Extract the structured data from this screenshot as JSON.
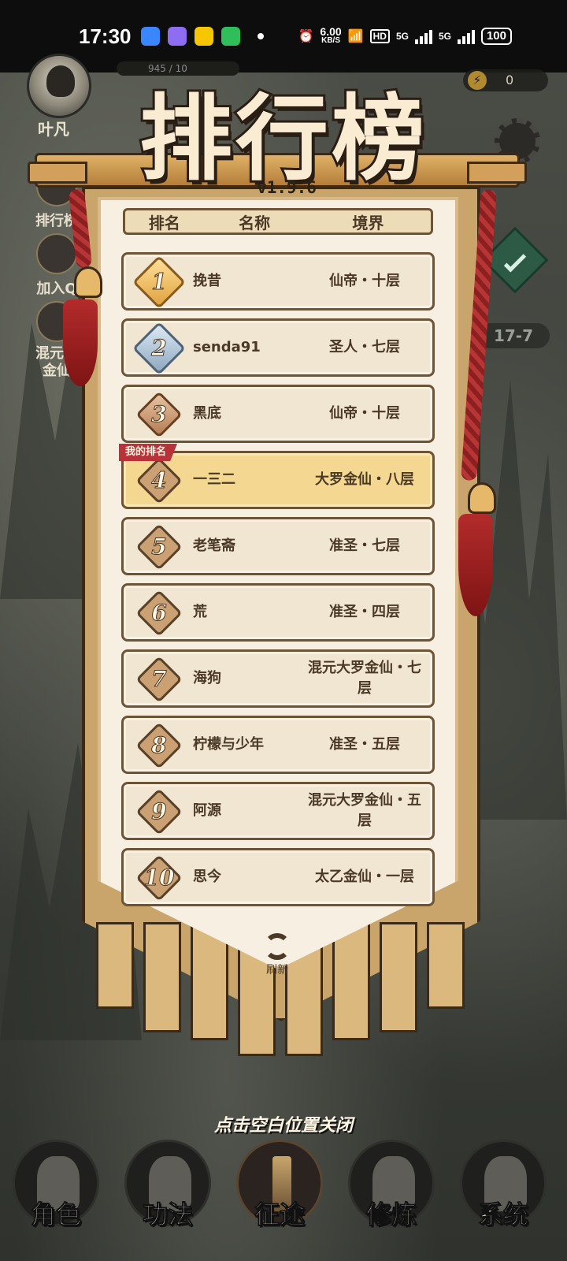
{
  "status_bar": {
    "time": "17:30",
    "net_speed": "6.00",
    "net_unit": "KB/S",
    "hd": "HD",
    "signal1": "5G",
    "signal2": "5G",
    "battery": "100",
    "app_colors": [
      "#3a86ff",
      "#8f6df2",
      "#f7c600",
      "#2fbf5a"
    ]
  },
  "hud": {
    "player_name": "叶凡",
    "exp_text": "945 / 10",
    "energy_value": "0",
    "stage": "17-7",
    "side_buttons": [
      "排行榜",
      "加入Q",
      "混元大金仙"
    ]
  },
  "leaderboard": {
    "title": "排行榜",
    "version": "v1.9.6",
    "columns": [
      "排名",
      "名称",
      "境界"
    ],
    "my_rank_tag": "我的排名",
    "rows": [
      {
        "rank": "1",
        "name": "挽昔",
        "realm": "仙帝・十层",
        "badge": "gold"
      },
      {
        "rank": "2",
        "name": "senda91",
        "realm": "圣人・七层",
        "badge": "silver"
      },
      {
        "rank": "3",
        "name": "黑底",
        "realm": "仙帝・十层",
        "badge": "bronze"
      },
      {
        "rank": "4",
        "name": "一三二",
        "realm": "大罗金仙・八层",
        "badge": "plain",
        "mine": true
      },
      {
        "rank": "5",
        "name": "老笔斋",
        "realm": "准圣・七层",
        "badge": "plain"
      },
      {
        "rank": "6",
        "name": "荒",
        "realm": "准圣・四层",
        "badge": "plain"
      },
      {
        "rank": "7",
        "name": "海狗",
        "realm": "混元大罗金仙・七层",
        "badge": "plain"
      },
      {
        "rank": "8",
        "name": "柠檬与少年",
        "realm": "准圣・五层",
        "badge": "plain"
      },
      {
        "rank": "9",
        "name": "阿源",
        "realm": "混元大罗金仙・五层",
        "badge": "plain"
      },
      {
        "rank": "10",
        "name": "思今",
        "realm": "太乙金仙・一层",
        "badge": "plain"
      }
    ],
    "refresh_label": "刷新",
    "close_hint": "点击空白位置关闭"
  },
  "bottom_nav": {
    "items": [
      {
        "label": "角色",
        "active": false
      },
      {
        "label": "功法",
        "active": false
      },
      {
        "label": "征途",
        "active": true
      },
      {
        "label": "修炼",
        "active": false
      },
      {
        "label": "系统",
        "active": false
      }
    ]
  }
}
